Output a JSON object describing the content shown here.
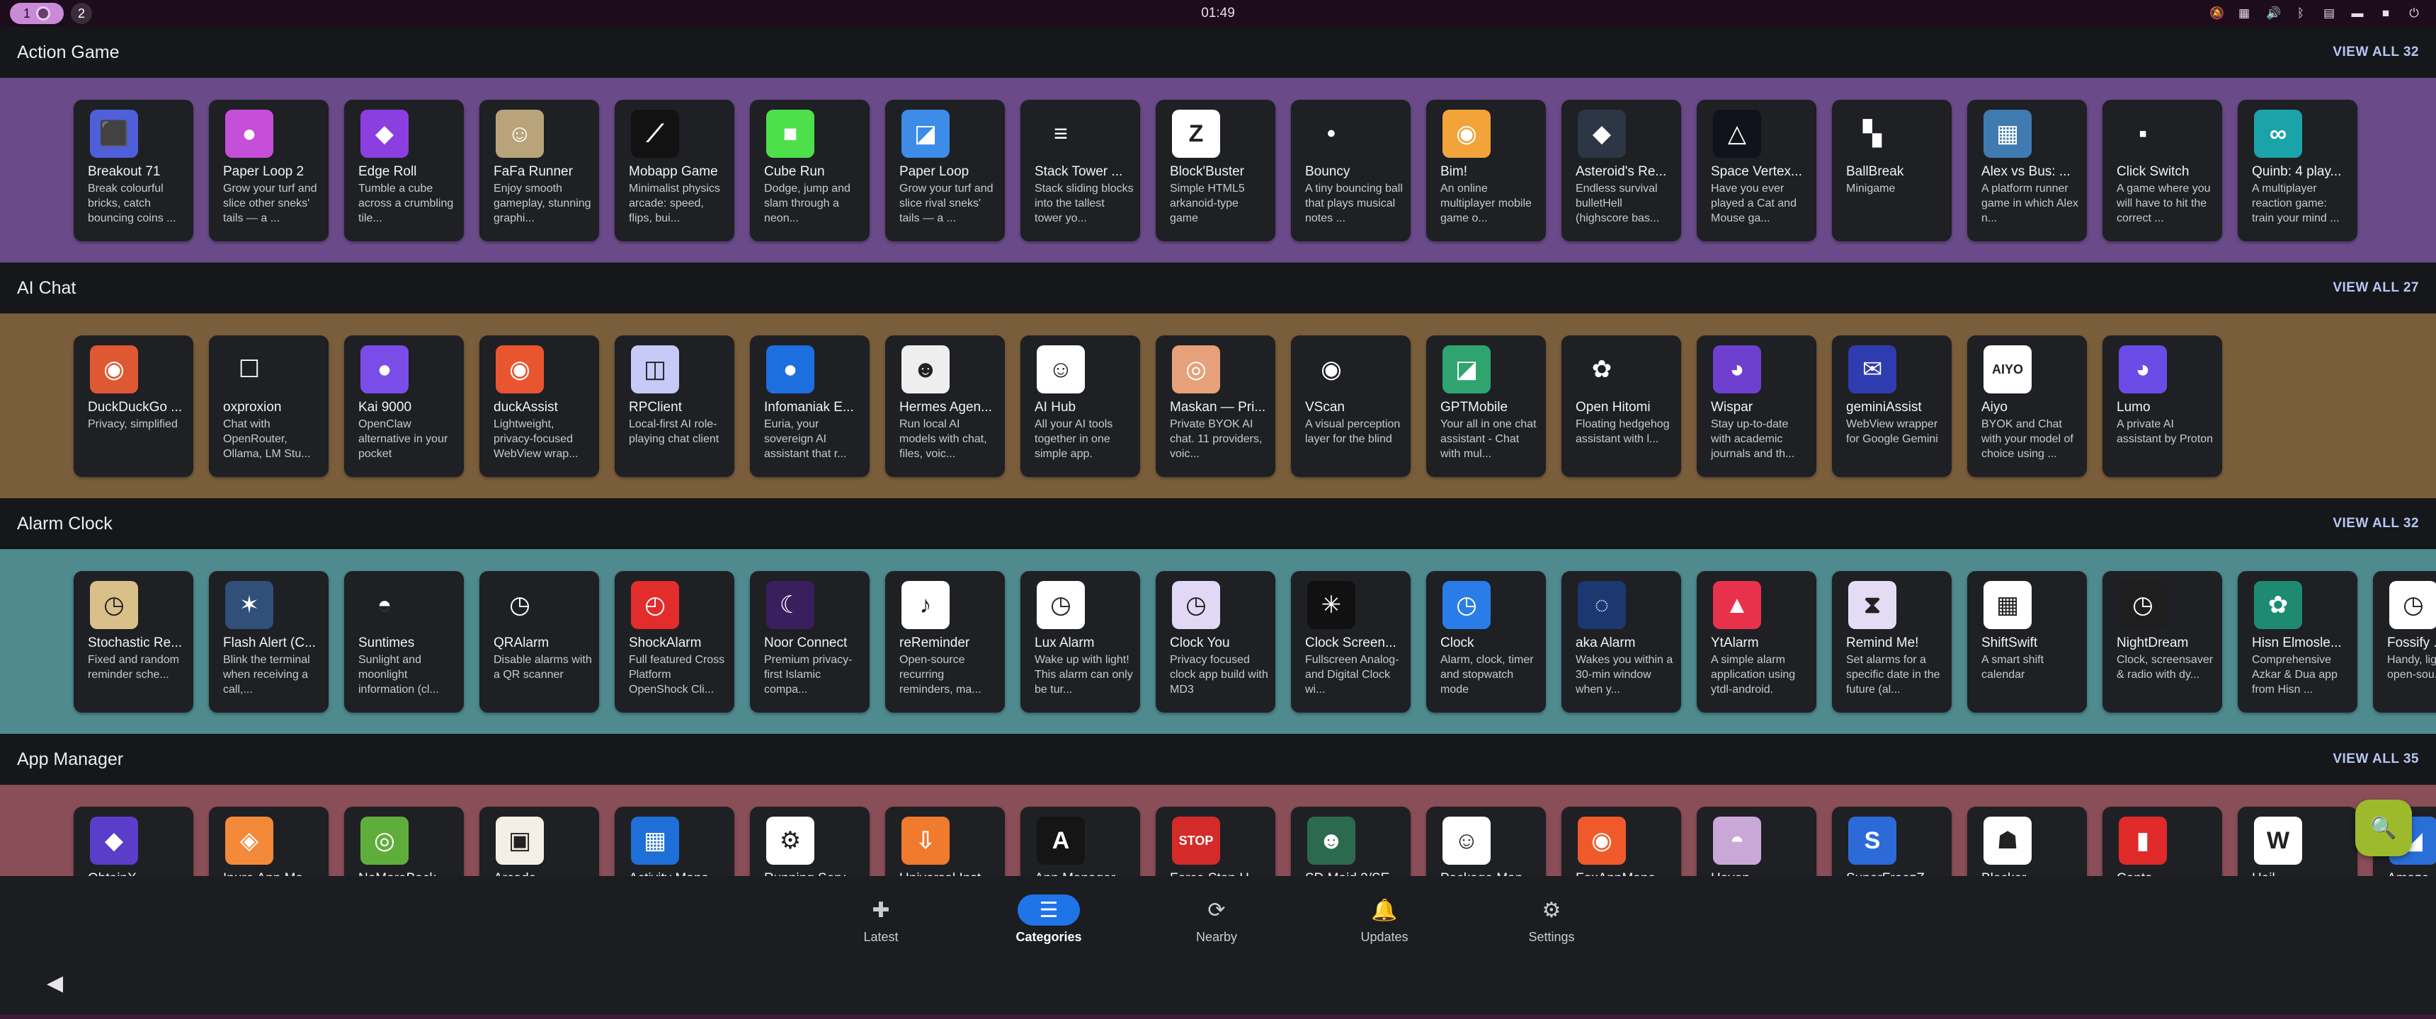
{
  "topbar": {
    "workspace_1": "1",
    "workspace_2": "2",
    "clock": "01:49"
  },
  "sections": [
    {
      "title": "Action Game",
      "view_all": "VIEW ALL 32",
      "band_color": "#6a4a88",
      "apps": [
        {
          "name": "Breakout 71",
          "summary": "Break colourful bricks, catch bouncing coins ...",
          "icon": "⬛",
          "bg": "#4e5fd9"
        },
        {
          "name": "Paper Loop 2",
          "summary": "Grow your turf and slice other sneks' tails — a ...",
          "icon": "●",
          "bg": "#c64fd9"
        },
        {
          "name": "Edge Roll",
          "summary": "Tumble a cube across a crumbling tile...",
          "icon": "◆",
          "bg": "#8b3fe0"
        },
        {
          "name": "FaFa Runner",
          "summary": "Enjoy smooth gameplay, stunning graphi...",
          "icon": "☺",
          "bg": "#b9a37a"
        },
        {
          "name": "Mobapp Game",
          "summary": "Minimalist physics arcade: speed, flips, bui...",
          "icon": "⟋",
          "bg": "#121212"
        },
        {
          "name": "Cube Run",
          "summary": "Dodge, jump and slam through a neon...",
          "icon": "■",
          "bg": "#4ee04a"
        },
        {
          "name": "Paper Loop",
          "summary": "Grow your turf and slice rival sneks' tails — a ...",
          "icon": "◪",
          "bg": "#3c8ce8"
        },
        {
          "name": "Stack Tower ...",
          "summary": "Stack sliding blocks into the tallest tower yo...",
          "icon": "≡",
          "bg": "#1e2024"
        },
        {
          "name": "Block'Buster",
          "summary": "Simple HTML5 arkanoid-type game",
          "icon": "Z",
          "bg": "#ffffff"
        },
        {
          "name": "Bouncy",
          "summary": "A tiny bouncing ball that plays musical notes ...",
          "icon": "•",
          "bg": "#1e2024"
        },
        {
          "name": "Bim!",
          "summary": "An online multiplayer mobile game o...",
          "icon": "◉",
          "bg": "#f2a33a"
        },
        {
          "name": "Asteroid's Re...",
          "summary": "Endless survival bulletHell (highscore bas...",
          "icon": "◆",
          "bg": "#2c3644"
        },
        {
          "name": "Space Vertex...",
          "summary": "Have you ever played a Cat and Mouse ga...",
          "icon": "△",
          "bg": "#10131c"
        },
        {
          "name": "BallBreak",
          "summary": "Minigame",
          "icon": "▚",
          "bg": "#1e2024"
        },
        {
          "name": "Alex vs Bus: ...",
          "summary": "A platform runner game in which Alex n...",
          "icon": "▦",
          "bg": "#3f7ab0"
        },
        {
          "name": "Click Switch",
          "summary": "A game where you will have to hit the correct ...",
          "icon": "▪",
          "bg": "#1e2024"
        },
        {
          "name": "Quinb: 4 play...",
          "summary": "A multiplayer reaction game: train your mind ...",
          "icon": "∞",
          "bg": "#1aa3a8"
        }
      ]
    },
    {
      "title": "AI Chat",
      "view_all": "VIEW ALL 27",
      "band_color": "#7a5e3c",
      "apps": [
        {
          "name": "DuckDuckGo ...",
          "summary": "Privacy, simplified",
          "icon": "◉",
          "bg": "#de5833"
        },
        {
          "name": "oxproxion",
          "summary": "Chat with OpenRouter, Ollama, LM Stu...",
          "icon": "☐",
          "bg": "#1e2024"
        },
        {
          "name": "Kai 9000",
          "summary": "OpenClaw alternative in your pocket",
          "icon": "●",
          "bg": "#7a4de8"
        },
        {
          "name": "duckAssist",
          "summary": "Lightweight, privacy-focused WebView wrap...",
          "icon": "◉",
          "bg": "#e8552f"
        },
        {
          "name": "RPClient",
          "summary": "Local-first AI role-playing chat client",
          "icon": "◫",
          "bg": "#c7c9f7"
        },
        {
          "name": "Infomaniak E...",
          "summary": "Euria, your sovereign AI assistant that r...",
          "icon": "●",
          "bg": "#1d6fe0"
        },
        {
          "name": "Hermes Agen...",
          "summary": "Run local AI models with chat, files, voic...",
          "icon": "☻",
          "bg": "#eeeeee"
        },
        {
          "name": "AI Hub",
          "summary": "All your AI tools together in one simple app.",
          "icon": "☺",
          "bg": "#ffffff"
        },
        {
          "name": "Maskan — Pri...",
          "summary": "Private BYOK AI chat. 11 providers, voic...",
          "icon": "◎",
          "bg": "#e6a07a"
        },
        {
          "name": "VScan",
          "summary": "A visual perception layer for the blind",
          "icon": "◉",
          "bg": "#1e2024"
        },
        {
          "name": "GPTMobile",
          "summary": "Your all in one chat assistant - Chat with mul...",
          "icon": "◪",
          "bg": "#2fa46e"
        },
        {
          "name": "Open Hitomi",
          "summary": "Floating hedgehog assistant with l...",
          "icon": "✿",
          "bg": "#1e2024"
        },
        {
          "name": "Wispar",
          "summary": "Stay up-to-date with academic journals and th...",
          "icon": "◕",
          "bg": "#6e3fcf"
        },
        {
          "name": "geminiAssist",
          "summary": "WebView wrapper for Google Gemini",
          "icon": "✉",
          "bg": "#2f3cb0"
        },
        {
          "name": "Aiyo",
          "summary": "BYOK and Chat with your model of choice using ...",
          "icon": "AIYO",
          "bg": "#ffffff"
        },
        {
          "name": "Lumo",
          "summary": "A private AI assistant by Proton",
          "icon": "◕",
          "bg": "#6b4be6"
        }
      ]
    },
    {
      "title": "Alarm Clock",
      "view_all": "VIEW ALL 32",
      "band_color": "#4e8a8e",
      "apps": [
        {
          "name": "Stochastic Re...",
          "summary": "Fixed and random reminder sche...",
          "icon": "◷",
          "bg": "#d9c08a"
        },
        {
          "name": "Flash Alert (C...",
          "summary": "Blink the terminal when receiving a call,...",
          "icon": "✶",
          "bg": "#30507a"
        },
        {
          "name": "Suntimes",
          "summary": "Sunlight and moonlight information (cl...",
          "icon": "◓",
          "bg": "#1e2024"
        },
        {
          "name": "QRAlarm",
          "summary": "Disable alarms with a QR scanner",
          "icon": "◷",
          "bg": "#1e2024"
        },
        {
          "name": "ShockAlarm",
          "summary": "Full featured Cross Platform OpenShock Cli...",
          "icon": "◴",
          "bg": "#e32c2c"
        },
        {
          "name": "Noor Connect",
          "summary": "Premium privacy-first Islamic compa...",
          "icon": "☾",
          "bg": "#3a1f5f"
        },
        {
          "name": "reReminder",
          "summary": "Open-source recurring reminders, ma...",
          "icon": "♪",
          "bg": "#ffffff"
        },
        {
          "name": "Lux Alarm",
          "summary": "Wake up with light! This alarm can only be tur...",
          "icon": "◷",
          "bg": "#ffffff"
        },
        {
          "name": "Clock You",
          "summary": "Privacy focused clock app build with MD3",
          "icon": "◷",
          "bg": "#e0d8f5"
        },
        {
          "name": "Clock Screen...",
          "summary": "Fullscreen Analog- and Digital Clock wi...",
          "icon": "✳",
          "bg": "#111111"
        },
        {
          "name": "Clock",
          "summary": "Alarm, clock, timer and stopwatch mode",
          "icon": "◷",
          "bg": "#2a7de8"
        },
        {
          "name": "aka Alarm",
          "summary": "Wakes you within a 30-min window when y...",
          "icon": "◌",
          "bg": "#1c3870"
        },
        {
          "name": "YtAlarm",
          "summary": "A simple alarm application using ytdl-android.",
          "icon": "▲",
          "bg": "#e8324b"
        },
        {
          "name": "Remind Me!",
          "summary": "Set alarms for a specific date in the future (al...",
          "icon": "⧗",
          "bg": "#e4dcf4"
        },
        {
          "name": "ShiftSwift",
          "summary": "A smart shift calendar",
          "icon": "▦",
          "bg": "#ffffff"
        },
        {
          "name": "NightDream",
          "summary": "Clock, screensaver & radio with dy...",
          "icon": "◷",
          "bg": "#1e1e1e"
        },
        {
          "name": "Hisn Elmosle...",
          "summary": "Comprehensive Azkar & Dua app from Hisn ...",
          "icon": "✿",
          "bg": "#1e8a72"
        },
        {
          "name": "Fossify ...",
          "summary": "Handy, lightweight, open-sou...",
          "icon": "◷",
          "bg": "#ffffff"
        }
      ]
    },
    {
      "title": "App Manager",
      "view_all": "VIEW ALL 35",
      "band_color": "#8a4e58",
      "apps": [
        {
          "name": "ObtainX",
          "summary": "",
          "icon": "◆",
          "bg": "#5a3ec9"
        },
        {
          "name": "Inure App Ma...",
          "summary": "",
          "icon": "◈",
          "bg": "#f28a3a"
        },
        {
          "name": "NoMoreBack",
          "summary": "",
          "icon": "◎",
          "bg": "#5fae3c"
        },
        {
          "name": "Arcade",
          "summary": "",
          "icon": "▣",
          "bg": "#f4efe6"
        },
        {
          "name": "Activity Mana...",
          "summary": "",
          "icon": "▦",
          "bg": "#1f6fd8"
        },
        {
          "name": "Running Serv...",
          "summary": "",
          "icon": "⚙",
          "bg": "#ffffff"
        },
        {
          "name": "Universal Inst...",
          "summary": "",
          "icon": "⇩",
          "bg": "#f07a2e"
        },
        {
          "name": "App Manager",
          "summary": "",
          "icon": "A",
          "bg": "#151515"
        },
        {
          "name": "Force Stop H...",
          "summary": "",
          "icon": "STOP",
          "bg": "#d42a2a"
        },
        {
          "name": "SD Maid 2/SE...",
          "summary": "",
          "icon": "☻",
          "bg": "#2c6a4e"
        },
        {
          "name": "Package Man...",
          "summary": "",
          "icon": "☺",
          "bg": "#ffffff"
        },
        {
          "name": "FoxAppMana...",
          "summary": "",
          "icon": "◉",
          "bg": "#f05a2a"
        },
        {
          "name": "Haven",
          "summary": "",
          "icon": "◓",
          "bg": "#c9a8d8"
        },
        {
          "name": "SuperFreezZ...",
          "summary": "",
          "icon": "S",
          "bg": "#2c6ad8"
        },
        {
          "name": "Blocker",
          "summary": "",
          "icon": "☗",
          "bg": "#ffffff"
        },
        {
          "name": "Canta",
          "summary": "",
          "icon": "▮",
          "bg": "#e02a2a"
        },
        {
          "name": "Hail",
          "summary": "",
          "icon": "W",
          "bg": "#ffffff"
        },
        {
          "name": "Amaze...",
          "summary": "",
          "icon": "◢",
          "bg": "#2a6fd8"
        }
      ]
    }
  ],
  "fab": {
    "icon": "search-icon",
    "glyph": "🔍"
  },
  "bottom_nav": [
    {
      "label": "Latest",
      "glyph": "✚",
      "active": false
    },
    {
      "label": "Categories",
      "glyph": "☰",
      "active": true
    },
    {
      "label": "Nearby",
      "glyph": "⟳",
      "active": false
    },
    {
      "label": "Updates",
      "glyph": "🔔",
      "active": false
    },
    {
      "label": "Settings",
      "glyph": "⚙",
      "active": false
    }
  ],
  "system_nav": {
    "back_glyph": "◀"
  }
}
